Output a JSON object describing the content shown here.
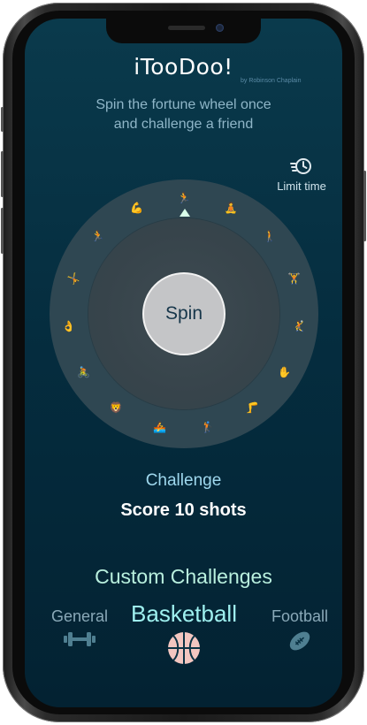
{
  "app": {
    "title": "iTooDoo!",
    "byline": "by Robinson Chaplain",
    "subtitle_line1": "Spin the fortune wheel once",
    "subtitle_line2": "and challenge a friend"
  },
  "limit_time": {
    "label": "Limit time",
    "icon": "stopwatch-icon"
  },
  "wheel": {
    "spin_label": "Spin",
    "segments": [
      "🏃",
      "🧘",
      "🚶",
      "🏋",
      "🤾",
      "✋",
      "🦵",
      "🏌",
      "🚣",
      "🦁",
      "🚴",
      "👌",
      "🤸",
      "🏃",
      "💪"
    ]
  },
  "challenge": {
    "label": "Challenge",
    "text": "Score 10 shots"
  },
  "custom": {
    "title": "Custom Challenges",
    "tabs": [
      {
        "label": "General",
        "icon": "dumbbell-icon",
        "selected": false
      },
      {
        "label": "Basketball",
        "icon": "basketball-icon",
        "selected": true
      },
      {
        "label": "Football",
        "icon": "football-icon",
        "selected": false
      }
    ]
  },
  "colors": {
    "background_top": "#0a3a4c",
    "background_bottom": "#032232",
    "accent_cyan": "#9ff0ef",
    "challenge_label": "#9fd8ee",
    "basketball": "#f3c6c0"
  }
}
